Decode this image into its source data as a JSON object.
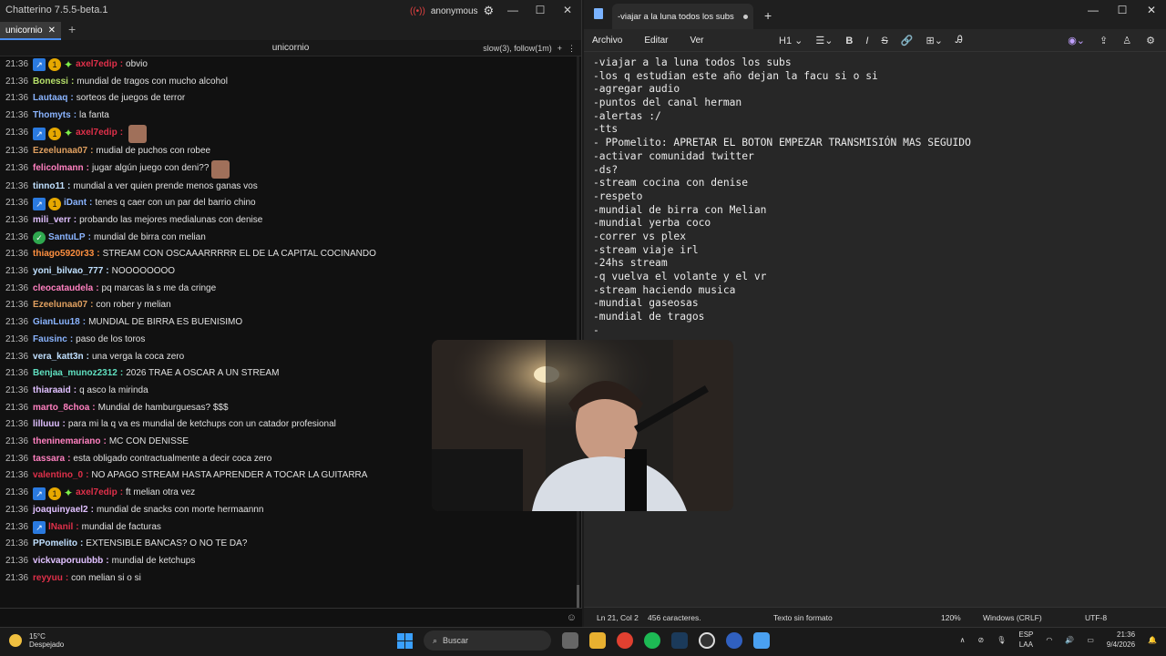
{
  "chatterino": {
    "title": "Chatterino 7.5.5-beta.1",
    "user": "anonymous",
    "tab_name": "unicornio",
    "channel": "unicornio",
    "modes": "slow(3), follow(1m)",
    "messages": [
      {
        "ts": "21:36",
        "user": "axel7edip",
        "color": "#e0304a",
        "text": "obvio",
        "badges": [
          "arrow",
          "gold",
          "star"
        ]
      },
      {
        "ts": "21:36",
        "user": "Bonessi",
        "color": "#b6e06a",
        "text": "mundial de tragos con mucho alcohol",
        "badges": []
      },
      {
        "ts": "21:36",
        "user": "Lautaaq",
        "color": "#8ab4ff",
        "text": "sorteos de juegos de terror",
        "badges": []
      },
      {
        "ts": "21:36",
        "user": "Thomyts",
        "color": "#8ab4ff",
        "text": "la fanta",
        "badges": []
      },
      {
        "ts": "21:36",
        "user": "axel7edip",
        "color": "#e0304a",
        "text": "",
        "badges": [
          "arrow",
          "gold",
          "star"
        ],
        "emote": true
      },
      {
        "ts": "21:36",
        "user": "Ezeelunaa07",
        "color": "#e0a060",
        "text": "mudial de puchos con robee",
        "badges": []
      },
      {
        "ts": "21:36",
        "user": "felicolmann",
        "color": "#ff80c0",
        "text": "jugar algún juego con deni??",
        "badges": [],
        "emote": true
      },
      {
        "ts": "21:36",
        "user": "tinno11",
        "color": "#c0e0ff",
        "text": "mundial a ver quien prende menos ganas vos",
        "badges": []
      },
      {
        "ts": "21:36",
        "user": "iDant",
        "color": "#8ab4ff",
        "text": "tenes q caer con un par del barrio chino",
        "badges": [
          "arrow",
          "gold"
        ]
      },
      {
        "ts": "21:36",
        "user": "mili_verr",
        "color": "#e0c0ff",
        "text": "probando las mejores medialunas con denise",
        "badges": []
      },
      {
        "ts": "21:36",
        "user": "SantuLP",
        "color": "#8ab4ff",
        "text": "mundial de birra con melian",
        "badges": [
          "green"
        ]
      },
      {
        "ts": "21:36",
        "user": "thiago5920r33",
        "color": "#ff9040",
        "text": "STREAM CON OSCAAARRRRR EL DE LA CAPITAL COCINANDO",
        "badges": []
      },
      {
        "ts": "21:36",
        "user": "yoni_bilvao_777",
        "color": "#c0e0ff",
        "text": "NOOOOOOOO",
        "badges": []
      },
      {
        "ts": "21:36",
        "user": "cleocataudela",
        "color": "#ff80c0",
        "text": "pq marcas la s me da cringe",
        "badges": []
      },
      {
        "ts": "21:36",
        "user": "Ezeelunaa07",
        "color": "#e0a060",
        "text": "con rober y melian",
        "badges": []
      },
      {
        "ts": "21:36",
        "user": "GianLuu18",
        "color": "#8ab4ff",
        "text": "MUNDIAL DE BIRRA ES BUENISIMO",
        "badges": []
      },
      {
        "ts": "21:36",
        "user": "Fausinc",
        "color": "#8ab4ff",
        "text": "paso de los toros",
        "badges": []
      },
      {
        "ts": "21:36",
        "user": "vera_katt3n",
        "color": "#c0e0ff",
        "text": "una verga la coca zero",
        "badges": []
      },
      {
        "ts": "21:36",
        "user": "Benjaa_munoz2312",
        "color": "#60e0c0",
        "text": "2026 TRAE A OSCAR A UN STREAM",
        "badges": []
      },
      {
        "ts": "21:36",
        "user": "thiaraaid",
        "color": "#e0c0ff",
        "text": "q asco la mirinda",
        "badges": []
      },
      {
        "ts": "21:36",
        "user": "marto_8choa",
        "color": "#ff80c0",
        "text": "Mundial de hamburguesas? $$$",
        "badges": []
      },
      {
        "ts": "21:36",
        "user": "lilluuu",
        "color": "#e0c0ff",
        "text": "para mi la q va es mundial de ketchups con un catador profesional",
        "badges": []
      },
      {
        "ts": "21:36",
        "user": "theninemariano",
        "color": "#ff80c0",
        "text": "MC CON DENISSE",
        "badges": []
      },
      {
        "ts": "21:36",
        "user": "tassara",
        "color": "#ff80c0",
        "text": "esta obligado contractualmente a decir coca zero",
        "badges": []
      },
      {
        "ts": "21:36",
        "user": "valentino_0",
        "color": "#e0304a",
        "text": "NO APAGO STREAM HASTA APRENDER A TOCAR LA GUITARRA",
        "badges": []
      },
      {
        "ts": "21:36",
        "user": "axel7edip",
        "color": "#e0304a",
        "text": "ft melian otra vez",
        "badges": [
          "arrow",
          "gold",
          "star"
        ]
      },
      {
        "ts": "21:36",
        "user": "joaquinyael2",
        "color": "#e0c0ff",
        "text": "mundial de snacks con morte hermaannn",
        "badges": []
      },
      {
        "ts": "21:36",
        "user": "lNanil",
        "color": "#e0304a",
        "text": "mundial de facturas",
        "badges": [
          "arrow"
        ]
      },
      {
        "ts": "21:36",
        "user": "PPomelito",
        "color": "#c0e0ff",
        "text": "EXTENSIBLE BANCAS? O NO TE DA?",
        "badges": []
      },
      {
        "ts": "21:36",
        "user": "vickvaporuubbb",
        "color": "#e0c0ff",
        "text": "mundial de ketchups",
        "badges": []
      },
      {
        "ts": "21:36",
        "user": "reyyuu",
        "color": "#e0304a",
        "text": "con melian si o si",
        "badges": []
      }
    ]
  },
  "notepad": {
    "tab_title": "-viajar a la luna todos los subs",
    "menu": [
      "Archivo",
      "Editar",
      "Ver"
    ],
    "heading_selector": "H1",
    "lines": [
      "-viajar a la luna todos los subs",
      "-los q estudian este año dejan la facu si o si",
      "-agregar audio",
      "-puntos del canal herman",
      "-alertas :/",
      "-tts",
      "- PPomelito: APRETAR EL BOTON EMPEZAR TRANSMISIÓN MAS SEGUIDO",
      "-activar comunidad twitter",
      "-ds?",
      "-stream cocina con denise",
      "-respeto",
      "-mundial de birra con Melian",
      "-mundial yerba coco",
      "-correr vs plex",
      "-stream viaje irl",
      "-24hs stream",
      "-q vuelva el volante y el vr",
      "-stream haciendo musica",
      "-mundial gaseosas",
      "-mundial de tragos",
      "-"
    ],
    "status": {
      "position": "Ln 21, Col 2",
      "chars": "456 caracteres.",
      "format": "Texto sin formato",
      "zoom": "120%",
      "eol": "Windows (CRLF)",
      "encoding": "UTF-8"
    }
  },
  "taskbar": {
    "temp": "15°C",
    "weather": "Despejado",
    "search_placeholder": "Buscar",
    "lang_top": "ESP",
    "lang_bottom": "LAA",
    "time": "21:36",
    "date": "9/4/2026"
  }
}
